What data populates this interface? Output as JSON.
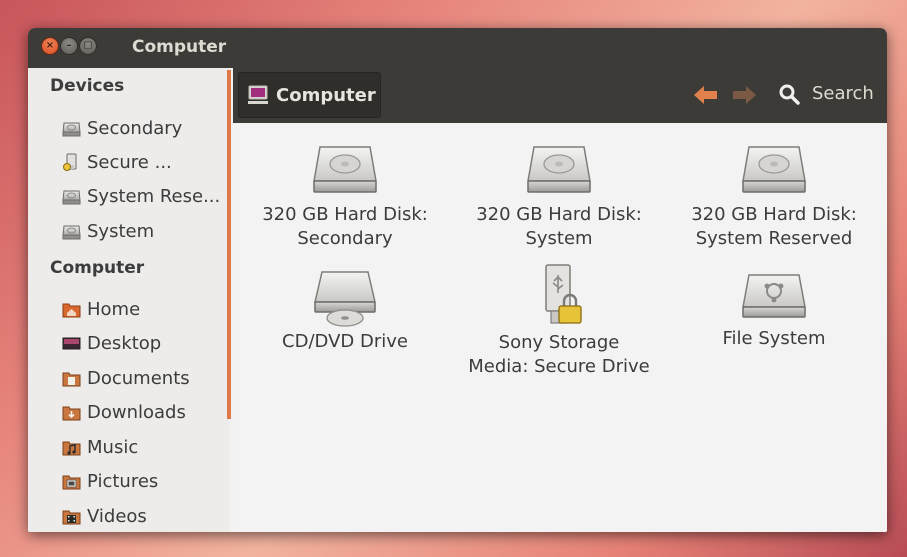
{
  "window": {
    "title": "Computer"
  },
  "sidebar": {
    "devices_heading": "Devices",
    "devices": [
      {
        "label": "Secondary",
        "icon": "hard-disk-icon"
      },
      {
        "label": "Secure ...",
        "icon": "usb-lock-icon"
      },
      {
        "label": "System Rese...",
        "icon": "hard-disk-icon"
      },
      {
        "label": "System",
        "icon": "hard-disk-icon"
      }
    ],
    "computer_heading": "Computer",
    "places": [
      {
        "label": "Home",
        "icon": "home-folder-icon"
      },
      {
        "label": "Desktop",
        "icon": "desktop-icon"
      },
      {
        "label": "Documents",
        "icon": "documents-folder-icon"
      },
      {
        "label": "Downloads",
        "icon": "downloads-folder-icon"
      },
      {
        "label": "Music",
        "icon": "music-folder-icon"
      },
      {
        "label": "Pictures",
        "icon": "pictures-folder-icon"
      },
      {
        "label": "Videos",
        "icon": "videos-folder-icon"
      }
    ]
  },
  "toolbar": {
    "location": "Computer",
    "search_label": "Search"
  },
  "files": [
    {
      "line1": "320 GB Hard Disk:",
      "line2": "Secondary",
      "icon": "hard-disk-icon"
    },
    {
      "line1": "320 GB Hard Disk:",
      "line2": "System",
      "icon": "hard-disk-icon"
    },
    {
      "line1": "320 GB Hard Disk:",
      "line2": "System Reserved",
      "icon": "hard-disk-icon"
    },
    {
      "line1": "CD/DVD Drive",
      "line2": "",
      "icon": "optical-drive-icon"
    },
    {
      "line1": "Sony Storage",
      "line2": "Media: Secure Drive",
      "icon": "usb-lock-icon"
    },
    {
      "line1": "File System",
      "line2": "",
      "icon": "filesystem-icon"
    }
  ],
  "colors": {
    "accent": "#e0794a",
    "titlebar": "#3c3b37",
    "nav_arrow": "#e0804a"
  }
}
